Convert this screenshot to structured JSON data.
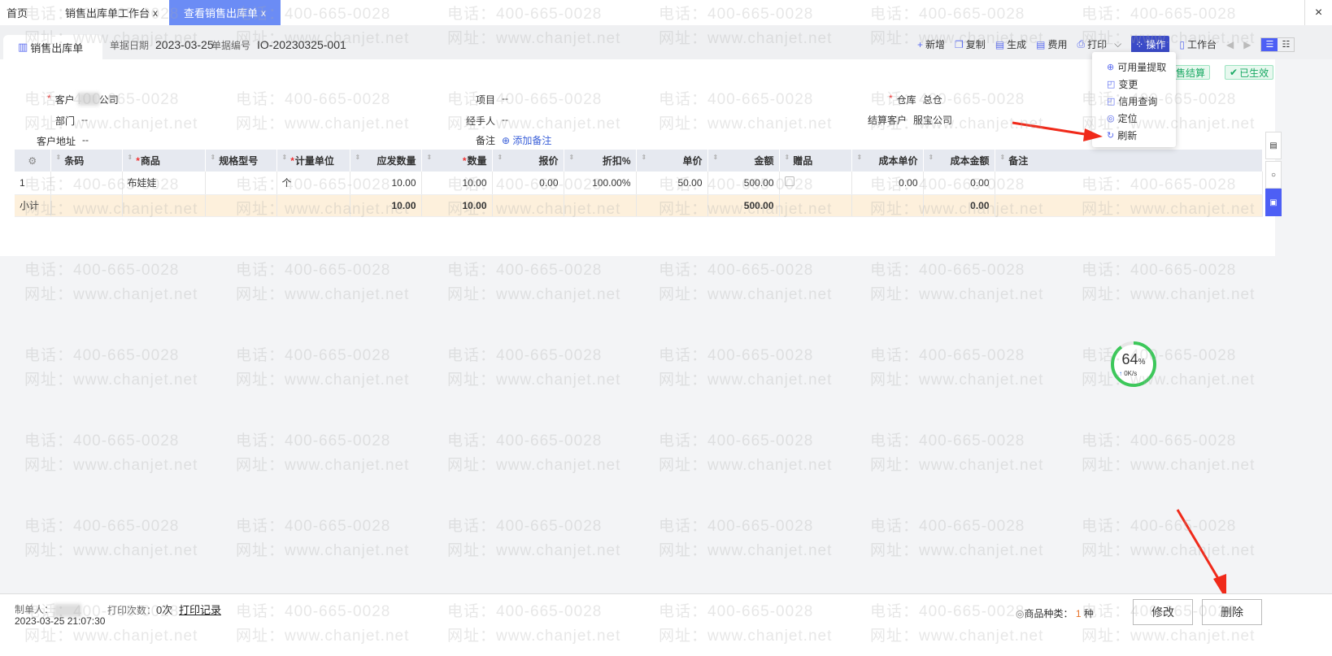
{
  "tabs": [
    {
      "label": "首页"
    },
    {
      "label": "销售出库单工作台",
      "close": "x"
    },
    {
      "label": "查看销售出库单",
      "close": "x"
    }
  ],
  "window_close": "×",
  "doc": {
    "title": "销售出库单",
    "date_label": "单据日期",
    "date": "2023-03-25",
    "no_label": "单据编号",
    "no": "IO-20230325-001"
  },
  "toolbar": {
    "add": "新增",
    "copy": "复制",
    "generate": "生成",
    "expense": "费用",
    "print": "打印",
    "operate": "操作",
    "workbench": "工作台"
  },
  "menu": [
    "可用量提取",
    "变更",
    "信用查询",
    "定位",
    "刷新"
  ],
  "badges": {
    "settle": "销售结算",
    "status": "已生效"
  },
  "fields": {
    "customer_label": "客户",
    "customer_suffix": "公司",
    "dept_label": "部门",
    "dept": "--",
    "addr_label": "客户地址",
    "addr": "--",
    "project_label": "项目",
    "project": "--",
    "handler_label": "经手人",
    "handler": "--",
    "note_label": "备注",
    "note_add": "添加备注",
    "warehouse_label": "仓库",
    "warehouse": "总仓",
    "settle_label": "结算客户",
    "settle": "服宝公司"
  },
  "table": {
    "headers": [
      "条码",
      "商品",
      "规格型号",
      "计量单位",
      "应发数量",
      "数量",
      "报价",
      "折扣%",
      "单价",
      "金额",
      "赠品",
      "成本单价",
      "成本金额",
      "备注"
    ],
    "rows": [
      [
        "1",
        "",
        "布娃娃",
        "",
        "个",
        "10.00",
        "10.00",
        "0.00",
        "100.00%",
        "50.00",
        "500.00",
        "",
        "0.00",
        "0.00",
        ""
      ]
    ],
    "subtotal": {
      "label": "小计",
      "due_qty": "10.00",
      "qty": "10.00",
      "amount": "500.00",
      "cost_amount": "0.00"
    }
  },
  "progress": {
    "percent": "64",
    "unit": "%",
    "speed": "0K/s",
    "value": 0.64
  },
  "watermark": {
    "line1": "电话：400-665-0028",
    "line2": "网址：www.chanjet.net"
  },
  "footer": {
    "creator_label": "制单人：",
    "created": "2023-03-25 21:07:30",
    "print_count_label": "打印次数：",
    "print_count": "0次",
    "print_log": "打印记录",
    "kinds_label": "商品种类：",
    "kinds": "1",
    "kinds_unit": "种",
    "edit": "修改",
    "delete": "删除"
  }
}
